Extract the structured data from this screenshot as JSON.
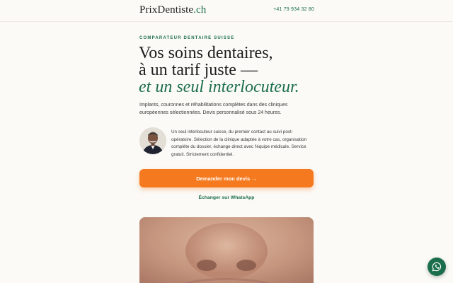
{
  "header": {
    "logo_name": "PrixDentiste",
    "logo_tld": ".ch",
    "phone": "+41 79 934 32 80"
  },
  "hero": {
    "eyebrow": "Comparateur dentaire suisse",
    "title_line1": "Vos soins dentaires,",
    "title_line2": "à un tarif juste —",
    "title_line3": "et un seul interlocuteur.",
    "intro": "Implants, couronnes et réhabilitations complètes dans des cliniques européennes sélectionnées. Devis personnalisé sous 24 heures."
  },
  "advisor": {
    "text": "Un seul interlocuteur suisse, du premier contact au suivi post-opératoire. Sélection de la clinique adaptée à votre cas, organisation complète du dossier, échange direct avec l'équipe médicale. Service gratuit. Strictement confidentiel."
  },
  "cta": {
    "label": "Demander mon devis →"
  },
  "whatsapp": {
    "link_label": "Échanger sur WhatsApp"
  },
  "icons": {
    "fab": "whatsapp-icon"
  },
  "colors": {
    "brand_green": "#1b6e4b",
    "cta_orange": "#f57a1f",
    "background": "#fbfaf7"
  }
}
